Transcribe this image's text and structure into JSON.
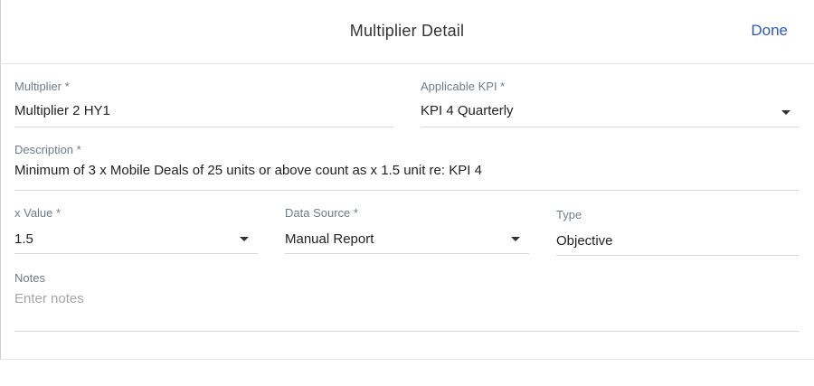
{
  "dialog": {
    "title": "Multiplier Detail",
    "done_label": "Done"
  },
  "form": {
    "multiplier": {
      "label": "Multiplier *",
      "value": "Multiplier 2 HY1"
    },
    "applicable_kpi": {
      "label": "Applicable KPI *",
      "value": "KPI 4 Quarterly"
    },
    "description": {
      "label": "Description *",
      "value": "Minimum of 3 x Mobile Deals of 25 units or above count as x 1.5 unit re: KPI 4"
    },
    "x_value": {
      "label": "x Value *",
      "value": "1.5"
    },
    "data_source": {
      "label": "Data Source *",
      "value": "Manual Report"
    },
    "type": {
      "label": "Type",
      "value": "Objective"
    },
    "notes": {
      "label": "Notes",
      "placeholder": "Enter notes",
      "value": ""
    }
  },
  "colors": {
    "accent": "#2b5bb8",
    "label": "#6f7c87",
    "underline": "#d9d9d9"
  }
}
